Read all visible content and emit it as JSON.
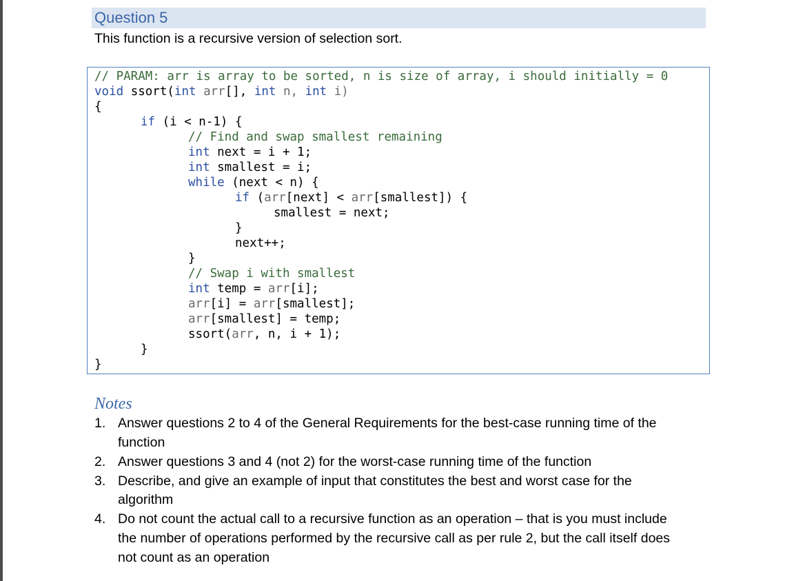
{
  "heading": "Question 5",
  "intro": "This function is a recursive version of selection sort.",
  "code": {
    "l1_comment": "// PARAM: arr is array to be sorted, n is size of array, i should initially = 0",
    "l2_void": "void",
    "l2_fn": " ssort(",
    "l2_int1": "int",
    "l2_arr": " arr",
    "l2_p1": "[], ",
    "l2_int2": "int",
    "l2_n": " n, ",
    "l2_int3": "int",
    "l2_i": " i)",
    "l3": "{",
    "l4_if": "if",
    "l4_rest": " (i < n-1) {",
    "l5_comment": "// Find and swap smallest remaining",
    "l6_int": "int",
    "l6_rest": " next = i + 1;",
    "l7_int": "int",
    "l7_rest": " smallest = i;",
    "l8_while": "while",
    "l8_rest": " (next < n) {",
    "l9_if": "if",
    "l9_a": " (",
    "l9_arr1": "arr",
    "l9_b": "[next] < ",
    "l9_arr2": "arr",
    "l9_c": "[smallest]) {",
    "l10": "smallest = next;",
    "l11": "}",
    "l12": "next++;",
    "l13": "}",
    "l14_comment": "// Swap i with smallest",
    "l15_int": "int",
    "l15_a": " temp = ",
    "l15_arr": "arr",
    "l15_b": "[i];",
    "l16_arr1": "arr",
    "l16_a": "[i] = ",
    "l16_arr2": "arr",
    "l16_b": "[smallest];",
    "l17_arr": "arr",
    "l17_a": "[smallest] = temp;",
    "l18_a": "ssort(",
    "l18_arr": "arr",
    "l18_b": ", n, i + 1);",
    "l19": "}",
    "l20": "}"
  },
  "notes": {
    "title": "Notes",
    "items": [
      {
        "num": "1.",
        "lines": [
          "Answer questions 2 to 4 of the General Requirements for the best-case running time of the",
          "function"
        ]
      },
      {
        "num": "2.",
        "lines": [
          "Answer questions 3 and 4 (not 2) for the worst-case running time of the function"
        ]
      },
      {
        "num": "3.",
        "lines": [
          "Describe, and give an example of input that constitutes the best and worst case for the",
          "algorithm"
        ]
      },
      {
        "num": "4.",
        "lines": [
          "Do not count the actual call to a recursive function as an operation – that is you must include",
          "the number of operations performed by the recursive call as per rule 2, but the call itself does",
          "not count as an operation"
        ]
      }
    ]
  }
}
